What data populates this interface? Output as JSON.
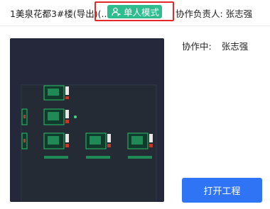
{
  "header": {
    "project_title": "1美泉花都3#楼(导出)(..",
    "mode_badge": {
      "label": "单人模式",
      "icon": "person-icon",
      "color": "#2dbd8e"
    },
    "highlight_color": "#e5282a",
    "owner_text": "协作负责人: 张志强"
  },
  "side": {
    "collab_label": "协作中:",
    "collab_name": "张志强",
    "open_button_label": "打开工程",
    "button_color": "#2f74f5"
  },
  "preview": {
    "background": "#25283a"
  }
}
